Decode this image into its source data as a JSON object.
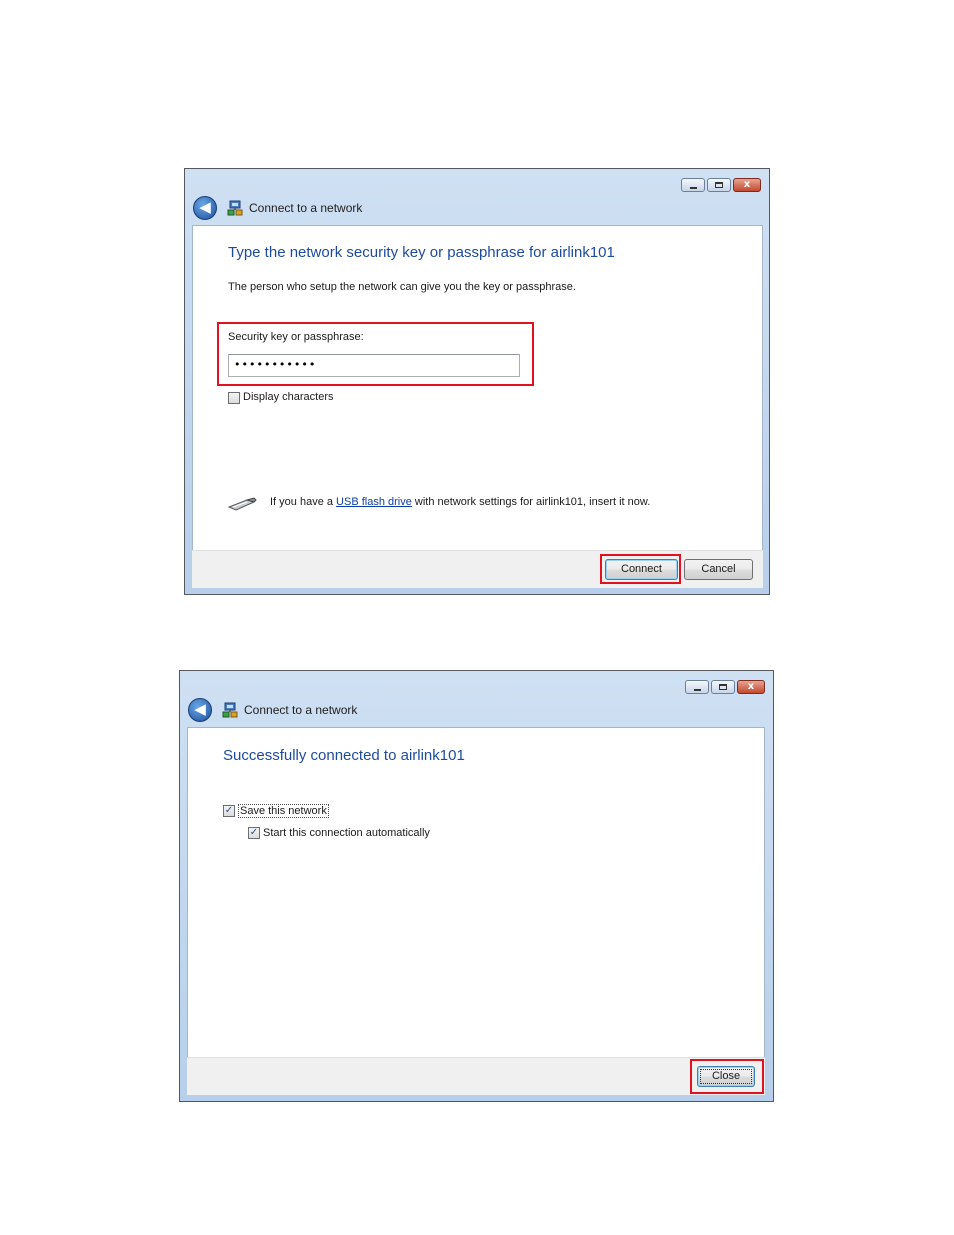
{
  "window1": {
    "title": "Connect to a network",
    "heading": "Type the network security key or passphrase for airlink101",
    "description": "The person who setup the network can give you the key or passphrase.",
    "field_label": "Security key or passphrase:",
    "field_value": "•••••••••••",
    "display_characters_label": "Display characters",
    "display_characters_checked": false,
    "usb_text_before": "If you have a ",
    "usb_link": "USB flash drive",
    "usb_text_after": " with network settings for airlink101, insert it now.",
    "connect_label": "Connect",
    "cancel_label": "Cancel"
  },
  "window2": {
    "title": "Connect to a network",
    "heading": "Successfully connected to airlink101",
    "save_network_label": "Save this network",
    "save_network_checked": true,
    "start_auto_label": "Start this connection automatically",
    "start_auto_checked": true,
    "close_label": "Close"
  },
  "titlebar": {
    "close_glyph": "x",
    "check_glyph": "✓",
    "back_glyph": "◀"
  },
  "colors": {
    "highlight": "#e0121f",
    "heading": "#1d4b9c",
    "link": "#0b3fa8"
  }
}
